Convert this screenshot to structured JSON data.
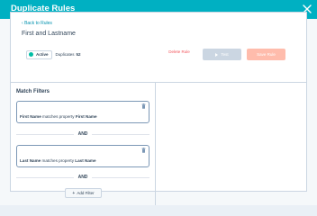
{
  "modal": {
    "title": "Duplicate Rules",
    "close_icon": "close-icon"
  },
  "header": {
    "back_label": "Back to Rules",
    "rule_name": "First and Lastname"
  },
  "status": {
    "active_label": "Active",
    "duplicates_label": "Duplicates",
    "duplicates_count": "52",
    "active_color": "#00bda5"
  },
  "actions": {
    "delete_label": "Delete Rule",
    "test_label": "Test",
    "save_label": "Save Rule"
  },
  "filters": {
    "heading": "Match Filters",
    "items": [
      {
        "field": "First Name",
        "connector": "matches property",
        "property": "First Name"
      },
      {
        "field": "Last Name",
        "connector": "matches property",
        "property": "Last Name"
      }
    ],
    "and_label": "AND",
    "add_label": "Add Filter"
  },
  "colors": {
    "header_bg": "#00b0c2",
    "link": "#0091ae",
    "danger": "#f2545b",
    "save_disabled": "#ffbcac",
    "test_disabled": "#cbd6e2"
  }
}
